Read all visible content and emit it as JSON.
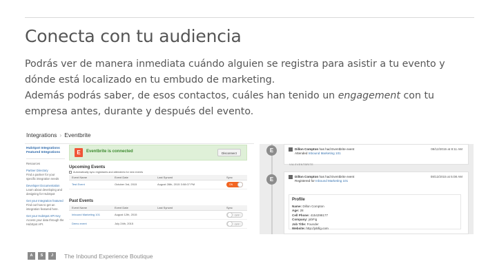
{
  "slide": {
    "title": "Conecta con tu audiencia",
    "para1": "Podrás ver de manera inmediata cuándo alguien se registra para asistir a tu evento y dónde está localizado en tu embudo de marketing.",
    "para2_before": "Además podrás saber, de esos contactos, cuáles han tenido un ",
    "para2_em": "engagement",
    "para2_after": " con tu empresa antes, durante y después del evento."
  },
  "integrations": {
    "breadcrumb_root": "Integrations",
    "breadcrumb_sep": "›",
    "breadcrumb_current": "Eventbrite",
    "sidebar": {
      "link1": "HubSpot Integrations",
      "link2": "Featured Integrations",
      "resources_label": "Resources",
      "res1_title": "Partner Directory",
      "res1_desc": "Find a partner for your specific integration needs",
      "res2_title": "Developer Documentation",
      "res2_desc": "Learn about developing and designing for HubSpot",
      "res3_title": "Get your Integration featured",
      "res3_desc": "Find out how to get an integration featured here.",
      "res4_title": "Get your HubSpot API Key",
      "res4_desc": "Access your data through the HubSpot API."
    },
    "banner": {
      "logo_letter": "E",
      "text": "Eventbrite is connected",
      "disconnect": "Disconnect"
    },
    "upcoming": {
      "title": "Upcoming Events",
      "auto_sync": "Automatically sync registrants and attendees for new events",
      "headers": [
        "Event Name",
        "Event Date",
        "Last Synced",
        "Sync"
      ],
      "rows": [
        {
          "name": "Test Event",
          "date": "October 3rd, 2015",
          "synced": "August 28th, 2015 3:08:07 PM",
          "sync": "ON"
        }
      ]
    },
    "past": {
      "title": "Past Events",
      "headers": [
        "Event Name",
        "Event Date",
        "Last Synced",
        "Sync"
      ],
      "rows": [
        {
          "name": "Inbound Marketing 101",
          "date": "August 12th, 2015",
          "synced": "",
          "sync": "OFF"
        },
        {
          "name": "Demo event",
          "date": "July 24th, 2015",
          "synced": "",
          "sync": "OFF"
        }
      ]
    }
  },
  "timeline": {
    "icon_letter": "E",
    "item1": {
      "name": "Dillon Compton",
      "action": "has had Eventbrite event",
      "status": "Attended",
      "event": "Inbound Marketing 101",
      "date": "08/12/2015 at 8:11 AM"
    },
    "via": "VIA EVENTBRITE",
    "item2": {
      "name": "Dillon Compton",
      "action": "has had Eventbrite event",
      "status": "Registered for",
      "event": "Inbound Marketing 101",
      "date": "08/12/2015 at 5:08 AM"
    },
    "profile": {
      "heading": "Profile",
      "name_label": "Name:",
      "name_value": "Dillon Compton",
      "age_label": "Age:",
      "age_value": "28",
      "phone_label": "Cell Phone:",
      "phone_value": "4154298177",
      "company_label": "Company:",
      "company_value": "jobFig",
      "job_label": "Job Title:",
      "job_value": "Founder",
      "web_label": "Website:",
      "web_value": "http://jobfig.com"
    }
  },
  "footer": {
    "tiles": [
      "A",
      "S",
      "J"
    ],
    "tagline": "The Inbound Experience Boutique"
  },
  "colors": {
    "accent_orange": "#f26522",
    "eventbrite_orange": "#f05537",
    "success_green": "#dff0d8",
    "link_blue": "#3572b0"
  }
}
